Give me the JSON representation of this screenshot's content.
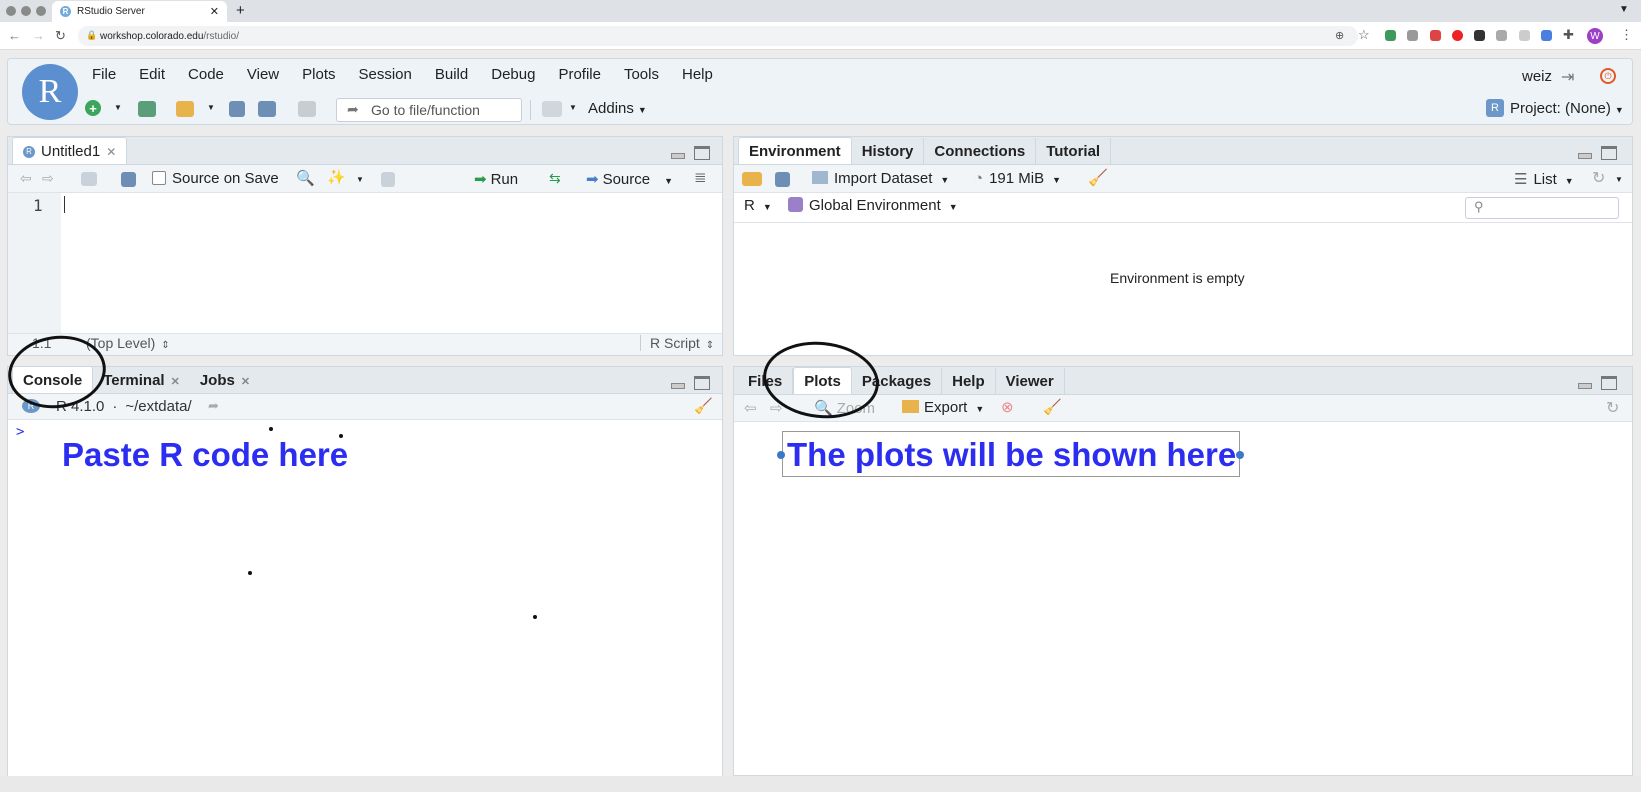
{
  "browser": {
    "tab_title": "RStudio Server",
    "new_tab_symbol": "+",
    "url_host": "workshop.colorado.edu",
    "url_path": "/rstudio/",
    "profile_initial": "W"
  },
  "rstudio": {
    "logo_letter": "R",
    "menu": [
      "File",
      "Edit",
      "Code",
      "View",
      "Plots",
      "Session",
      "Build",
      "Debug",
      "Profile",
      "Tools",
      "Help"
    ],
    "user": "weiz",
    "goto_placeholder": "Go to file/function",
    "addins": "Addins",
    "project": "Project: (None)"
  },
  "editor": {
    "tab": "Untitled1",
    "source_on_save": "Source on Save",
    "run": "Run",
    "source": "Source",
    "line_number": "1",
    "cursor_pos": "1:1",
    "scope": "(Top Level)",
    "file_type": "R Script"
  },
  "console": {
    "tabs": [
      "Console",
      "Terminal",
      "Jobs"
    ],
    "r_version": "R 4.1.0",
    "separator": "·",
    "path": "~/extdata/",
    "prompt": ">",
    "annotation": "Paste R code here"
  },
  "environment": {
    "tabs": [
      "Environment",
      "History",
      "Connections",
      "Tutorial"
    ],
    "import_dataset": "Import Dataset",
    "memory": "191 MiB",
    "view_mode": "List",
    "language": "R",
    "scope": "Global Environment",
    "empty_message": "Environment is empty"
  },
  "plots": {
    "tabs": [
      "Files",
      "Plots",
      "Packages",
      "Help",
      "Viewer"
    ],
    "zoom": "Zoom",
    "export": "Export",
    "annotation": "The plots will be shown here"
  },
  "colors": {
    "annotation_text": "#2b2ef0",
    "rstudio_blue": "#5b8fd0"
  }
}
